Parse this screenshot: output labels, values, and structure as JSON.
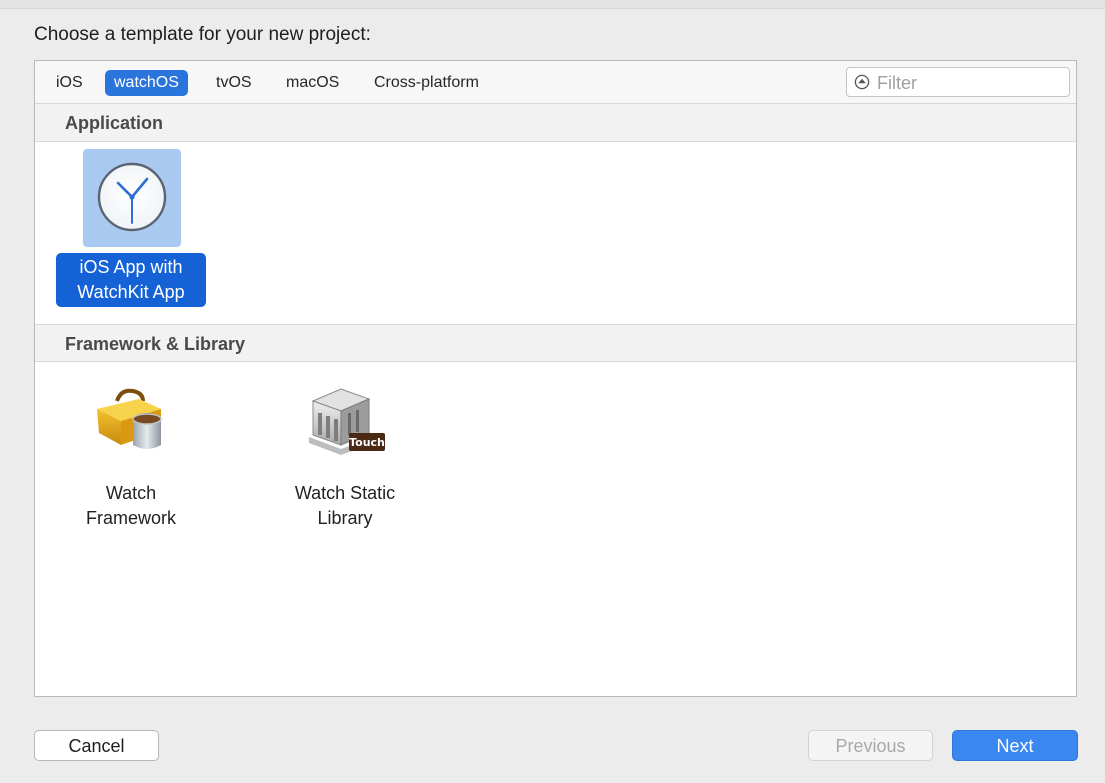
{
  "dialog": {
    "heading": "Choose a template for your new project:"
  },
  "platform_tabs": [
    {
      "label": "iOS",
      "selected": false
    },
    {
      "label": "watchOS",
      "selected": true
    },
    {
      "label": "tvOS",
      "selected": false
    },
    {
      "label": "macOS",
      "selected": false
    },
    {
      "label": "Cross-platform",
      "selected": false
    }
  ],
  "filter": {
    "placeholder": "Filter",
    "value": "",
    "icon": "filter-icon"
  },
  "sections": [
    {
      "title": "Application",
      "templates": [
        {
          "label_line1": "iOS App with",
          "label_line2": "WatchKit App",
          "icon": "watch-clock-icon",
          "selected": true
        }
      ]
    },
    {
      "title": "Framework & Library",
      "templates": [
        {
          "label_line1": "Watch",
          "label_line2": "Framework",
          "icon": "toolbox-icon",
          "selected": false
        },
        {
          "label_line1": "Watch Static",
          "label_line2": "Library",
          "icon": "library-building-icon",
          "badge": "Touch",
          "selected": false
        }
      ]
    }
  ],
  "buttons": {
    "cancel": "Cancel",
    "previous": "Previous",
    "next": "Next"
  },
  "colors": {
    "accent": "#2a75dc",
    "selection_label": "#1561d6",
    "selection_icon_bg": "#a9c9f1",
    "next_button": "#3b87f0"
  }
}
